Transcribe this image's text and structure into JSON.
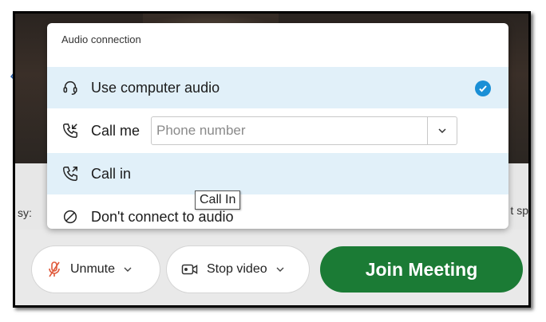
{
  "audio_panel": {
    "header": "Audio connection",
    "options": [
      {
        "label": "Use computer audio",
        "icon": "headset-icon",
        "selected": true
      },
      {
        "label": "Call me",
        "icon": "phone-incoming-icon"
      },
      {
        "label": "Call in",
        "icon": "phone-outgoing-icon"
      },
      {
        "label": "Don't connect to audio",
        "icon": "no-audio-icon"
      }
    ],
    "phone_placeholder": "Phone number",
    "tooltip": "Call In"
  },
  "background": {
    "left_text": "sy:",
    "right_text": "t sp"
  },
  "controls": {
    "unmute_label": "Unmute",
    "stop_video_label": "Stop video",
    "join_label": "Join Meeting"
  },
  "colors": {
    "accent": "#1a8fd6",
    "join": "#1b7b35",
    "selected_bg": "#e1f0f9",
    "mute_icon": "#e05a3c"
  }
}
